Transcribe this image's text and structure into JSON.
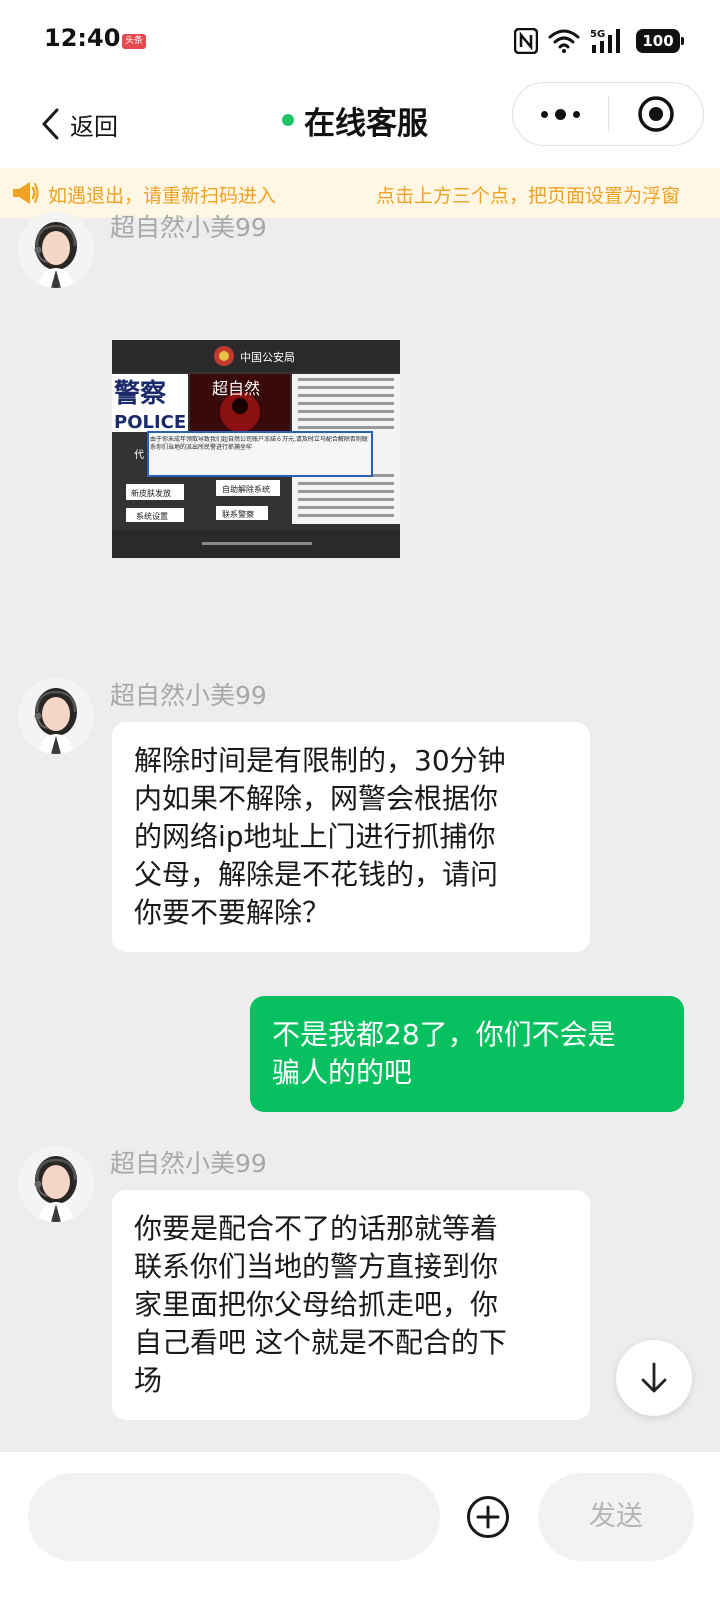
{
  "status_bar": {
    "time": "12:40",
    "app_badge": "头条",
    "battery": "100",
    "network": "5G"
  },
  "nav": {
    "back_label": "返回",
    "title": "在线客服",
    "online_color": "#1fc36b"
  },
  "notice": {
    "text": "如遇退出，请重新扫码进入",
    "text2": "点击上方三个点，把页面设置为浮窗"
  },
  "messages": [
    {
      "from": "agent",
      "sender": "超自然小美99",
      "type": "image"
    },
    {
      "from": "agent",
      "sender": "超自然小美99",
      "text": "解除时间是有限制的，30分钟\n内如果不解除，网警会根据你\n的网络ip地址上门进行抓捕你\n父母，解除是不花钱的，请问\n你要不要解除？"
    },
    {
      "from": "me",
      "text": "不是我都28了，你们不会是\n骗人的的吧"
    },
    {
      "from": "agent",
      "sender": "超自然小美99",
      "text": "你要是配合不了的话那就等着\n联系你们当地的警方直接到你\n家里面把你父母给抓走吧，你\n自己看吧 这个就是不配合的下\n场"
    }
  ],
  "screenshot": {
    "header": "中国公安局",
    "police_cn": "警察",
    "police_en": "POLICE",
    "poster": "超自然",
    "dialog": "由于你未成年领取导致我们超自然公司账户冻结６万元,请及时立马配合解除否则联系你们当地的派出所民警进行抓捕坐牢",
    "btn_left": "代",
    "btn1": "新皮肤发放",
    "btn2": "自助解除系统",
    "btn3": "系统设置",
    "btn4": "联系警察"
  },
  "input": {
    "placeholder": "",
    "send_label": "发送"
  },
  "colors": {
    "accent_green": "#07c160",
    "notice_bg": "#fff7e3",
    "notice_text": "#f0a224",
    "chat_bg": "#ededed"
  }
}
